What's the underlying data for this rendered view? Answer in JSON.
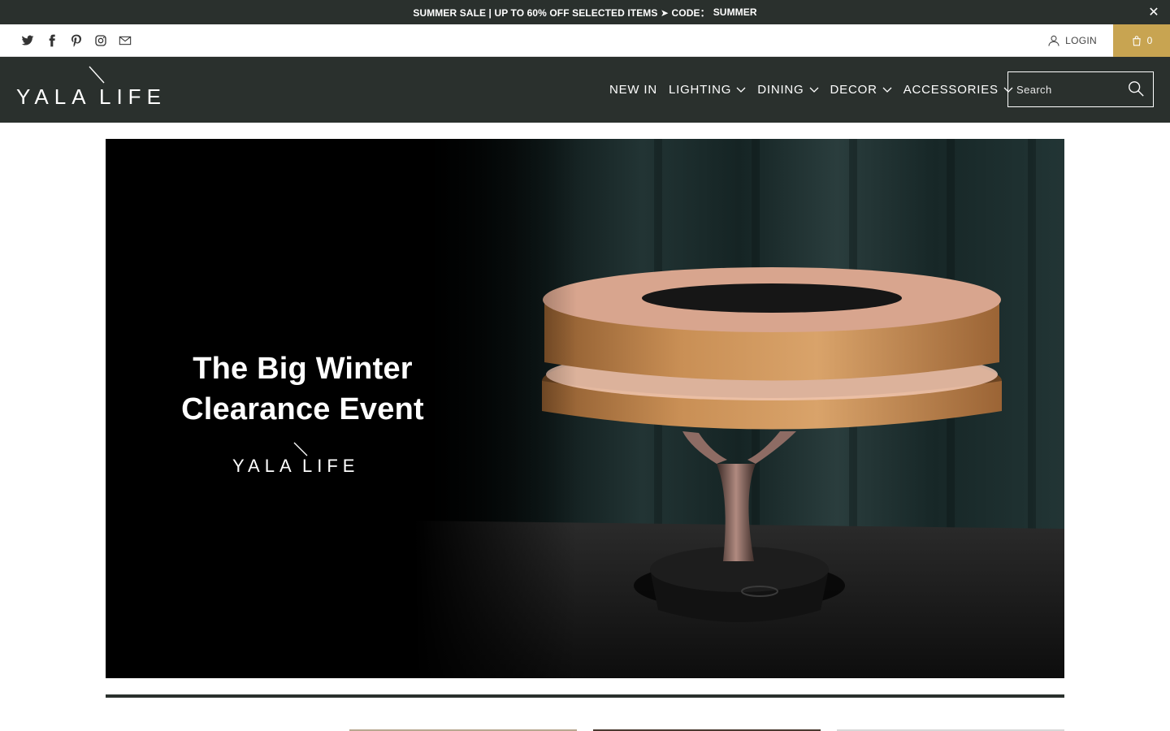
{
  "announcement": {
    "text": "SUMMER SALE | UP TO 60% OFF SELECTED ITEMS ➤ CODE：",
    "code": "SUMMER",
    "close_icon": "close-icon"
  },
  "social_icons": [
    "twitter-icon",
    "facebook-icon",
    "pinterest-icon",
    "instagram-icon",
    "email-icon"
  ],
  "account": {
    "login_label": "LOGIN",
    "cart_count": "0"
  },
  "brand": {
    "logo_text_1": "YALA",
    "logo_text_2": "LIFE"
  },
  "nav": {
    "items": [
      {
        "label": "NEW IN",
        "has_dropdown": false
      },
      {
        "label": "LIGHTING",
        "has_dropdown": true
      },
      {
        "label": "DINING",
        "has_dropdown": true
      },
      {
        "label": "DECOR",
        "has_dropdown": true
      },
      {
        "label": "ACCESSORIES",
        "has_dropdown": true
      }
    ]
  },
  "search": {
    "placeholder": "Search"
  },
  "hero": {
    "title_line_1": "The Big Winter",
    "title_line_2": "Clearance Event",
    "logo_text_1": "YALA",
    "logo_text_2": "LIFE"
  },
  "colors": {
    "header_bg": "#2a302d",
    "accent_gold": "#c8a451",
    "white": "#ffffff"
  }
}
